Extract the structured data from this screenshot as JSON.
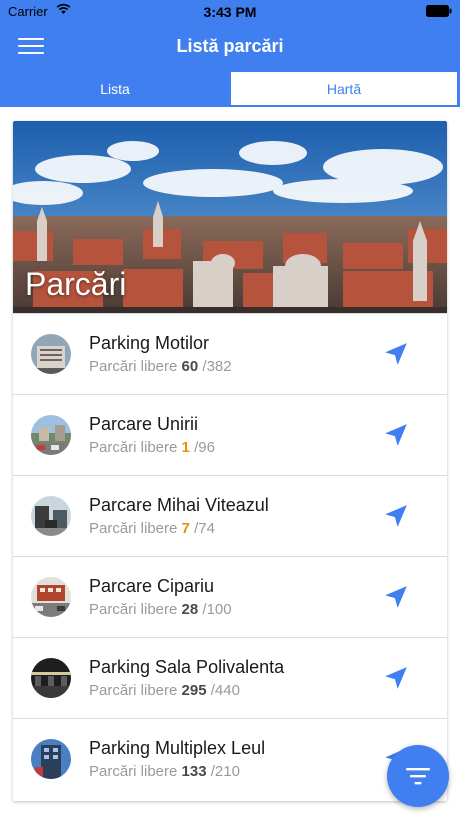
{
  "status_bar": {
    "carrier": "Carrier",
    "time": "3:43 PM"
  },
  "nav_bar": {
    "title": "Listă parcări"
  },
  "tabs": [
    {
      "label": "Lista",
      "selected": true
    },
    {
      "label": "Hartă",
      "selected": false
    }
  ],
  "hero": {
    "title": "Parcări"
  },
  "parkings": [
    {
      "name": "Parking Motilor",
      "free_label": "Parcări libere",
      "free": "60",
      "total": "/382",
      "low": false
    },
    {
      "name": "Parcare Unirii",
      "free_label": "Parcări libere",
      "free": "1",
      "total": "/96",
      "low": true
    },
    {
      "name": "Parcare Mihai Viteazul",
      "free_label": "Parcări libere",
      "free": "7",
      "total": "/74",
      "low": true
    },
    {
      "name": "Parcare Cipariu",
      "free_label": "Parcări libere",
      "free": "28",
      "total": "/100",
      "low": false
    },
    {
      "name": "Parking Sala Polivalenta",
      "free_label": "Parcări libere",
      "free": "295",
      "total": "/440",
      "low": false
    },
    {
      "name": "Parking Multiplex Leul",
      "free_label": "Parcări libere",
      "free": "133",
      "total": "/210",
      "low": false
    }
  ],
  "icons": {
    "menu": "hamburger-icon",
    "navigate": "navigation-arrow-icon",
    "filter": "filter-icon",
    "wifi": "wifi-icon",
    "battery": "battery-icon"
  },
  "colors": {
    "primary": "#3f7ff0",
    "low_availability": "#f08a12",
    "text_secondary": "#9a9a9a"
  }
}
